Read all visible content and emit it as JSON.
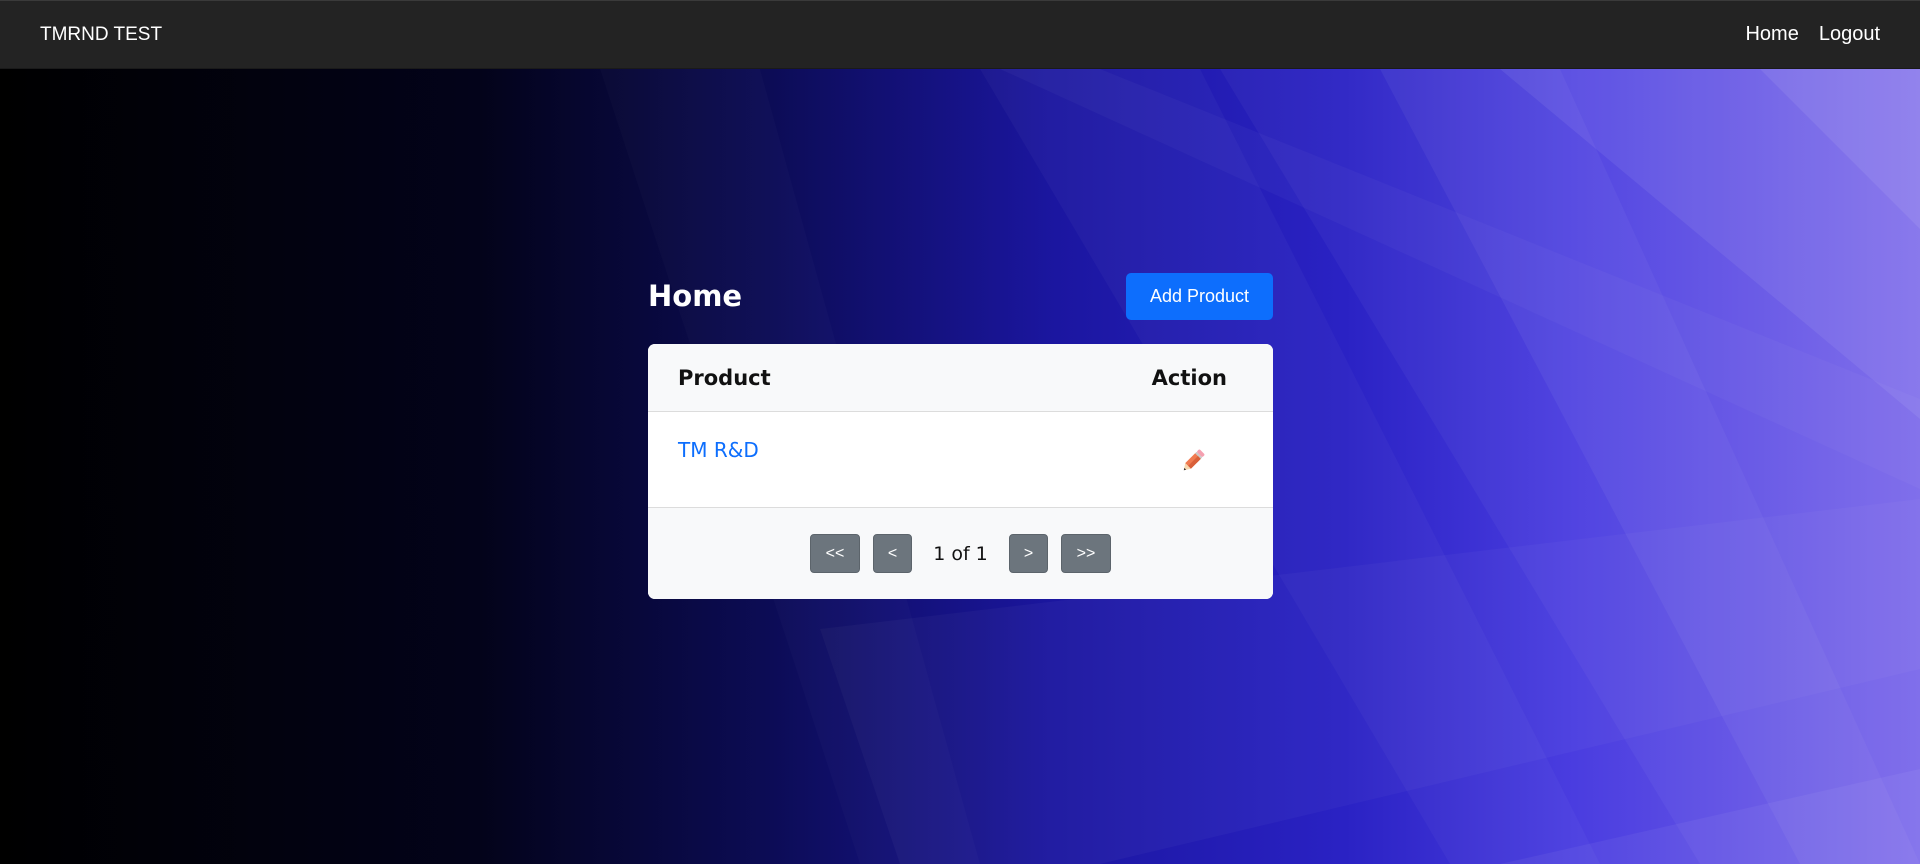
{
  "navbar": {
    "brand": "TMRND TEST",
    "links": [
      {
        "label": "Home"
      },
      {
        "label": "Logout"
      }
    ]
  },
  "page": {
    "title": "Home",
    "add_button_label": "Add Product"
  },
  "table": {
    "columns": [
      "Product",
      "Action"
    ],
    "rows": [
      {
        "product": "TM R&D",
        "action_icon": "pencil-icon"
      }
    ]
  },
  "pagination": {
    "first_label": "<<",
    "prev_label": "<",
    "info": "1 of 1",
    "next_label": ">",
    "last_label": ">>"
  },
  "colors": {
    "navbar_bg": "#232323",
    "primary": "#0d6efd",
    "secondary": "#6c757d",
    "pencil": "#f07a50"
  }
}
